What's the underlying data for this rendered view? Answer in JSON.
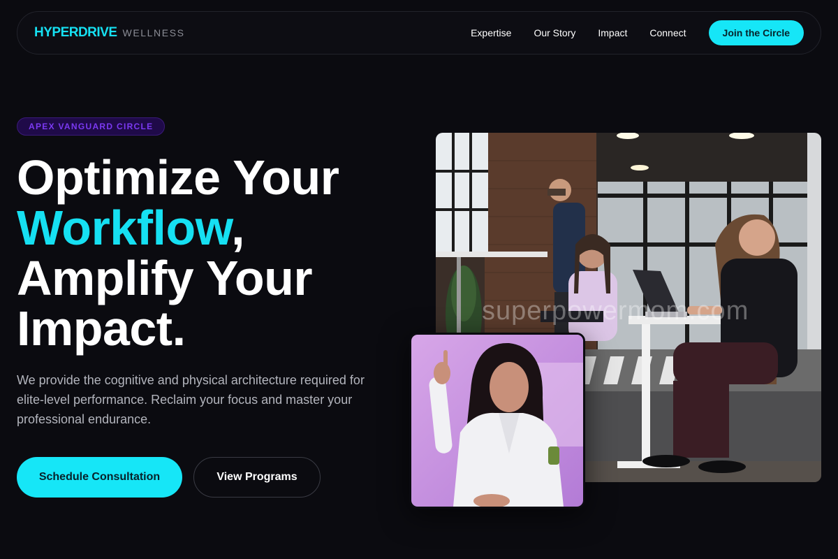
{
  "brand": {
    "name": "HYPERDRIVE",
    "suffix": "WELLNESS",
    "accent_color": "#16e0f2"
  },
  "nav": {
    "links": [
      "Expertise",
      "Our Story",
      "Impact",
      "Connect"
    ],
    "cta_label": "Join the Circle"
  },
  "hero": {
    "badge": "APEX VANGUARD CIRCLE",
    "headline": {
      "line1": "Optimize Your",
      "accent": "Workflow",
      "comma": ",",
      "line3": "Amplify Your",
      "line4": "Impact."
    },
    "lead": "We provide the cognitive and physical architecture required for elite-level performance. Reclaim your focus and master your professional endurance.",
    "primary_cta": "Schedule Consultation",
    "secondary_cta": "View Programs"
  },
  "images": {
    "main_watermark": "superpowermom.com",
    "main_icon": "office-coworkers-photo",
    "inset_icon": "doctor-portrait-photo"
  }
}
